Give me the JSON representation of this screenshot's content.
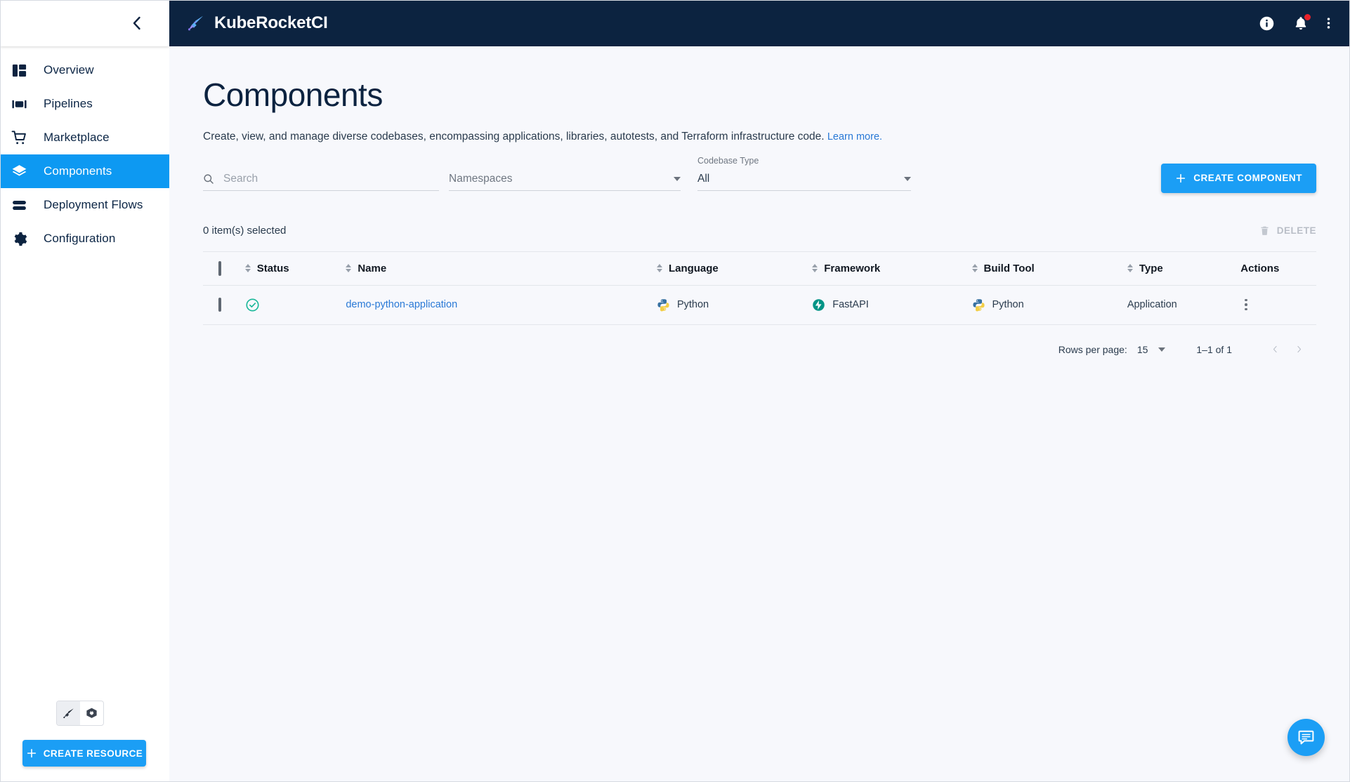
{
  "app": {
    "brand_name": "KubeRocketCI",
    "brand_logo_icon": "rocket-sword-logo-icon",
    "accent_color": "#1b9ef5",
    "topbar_color": "#0c2340",
    "background_color": "#f7f8fc"
  },
  "topbar": {
    "info_icon": "info-circle-icon",
    "notifications_icon": "bell-icon",
    "notifications_has_unread": true,
    "overflow_icon": "more-vertical-icon"
  },
  "sidebar": {
    "collapse_icon": "chevron-left-icon",
    "items": [
      {
        "label": "Overview",
        "icon": "dashboard-grid-icon",
        "active": false
      },
      {
        "label": "Pipelines",
        "icon": "pipelines-icon",
        "active": false
      },
      {
        "label": "Marketplace",
        "icon": "shopping-cart-icon",
        "active": false
      },
      {
        "label": "Components",
        "icon": "layers-icon",
        "active": true
      },
      {
        "label": "Deployment Flows",
        "icon": "deployment-flows-icon",
        "active": false
      },
      {
        "label": "Configuration",
        "icon": "gear-icon",
        "active": false
      }
    ],
    "view_toggle": [
      {
        "name": "krci-view",
        "icon": "rocket-sword-icon",
        "selected": true
      },
      {
        "name": "kubernetes-view",
        "icon": "kubernetes-wheel-icon",
        "selected": false
      }
    ],
    "create_resource_label": "CREATE RESOURCE",
    "create_resource_icon": "plus-icon"
  },
  "page": {
    "title": "Components",
    "description": "Create, view, and manage diverse codebases, encompassing applications, libraries, autotests, and Terraform infrastructure code.",
    "learn_more_label": "Learn more."
  },
  "filters": {
    "search": {
      "placeholder": "Search",
      "value": "",
      "icon": "search-icon"
    },
    "namespaces": {
      "label": "",
      "placeholder": "Namespaces",
      "value": "",
      "icon": "chevron-down-icon"
    },
    "codebase_type": {
      "label": "Codebase Type",
      "value": "All",
      "icon": "chevron-down-icon"
    },
    "create_component_label": "CREATE COMPONENT",
    "create_component_icon": "plus-icon"
  },
  "selection": {
    "summary": "0 item(s) selected",
    "delete_label": "DELETE",
    "delete_icon": "trash-icon"
  },
  "table": {
    "select_all_checkbox": "unchecked",
    "columns": [
      {
        "label": "Status",
        "sortable": true
      },
      {
        "label": "Name",
        "sortable": true
      },
      {
        "label": "Language",
        "sortable": true
      },
      {
        "label": "Framework",
        "sortable": true
      },
      {
        "label": "Build Tool",
        "sortable": true
      },
      {
        "label": "Type",
        "sortable": true
      },
      {
        "label": "Actions",
        "sortable": false
      }
    ],
    "rows": [
      {
        "checkbox": "unchecked",
        "status": "ok",
        "status_icon": "check-circle-icon",
        "status_color": "#1bb89a",
        "name": "demo-python-application",
        "language": "Python",
        "language_icon": "python-logo-icon",
        "framework": "FastAPI",
        "framework_icon": "fastapi-logo-icon",
        "framework_color": "#029486",
        "build_tool": "Python",
        "build_tool_icon": "python-logo-icon",
        "type": "Application",
        "actions_icon": "more-vertical-icon"
      }
    ]
  },
  "pagination": {
    "rows_per_page_label": "Rows per page:",
    "rows_per_page_value": "15",
    "range_label": "1–1 of 1",
    "prev_icon": "chevron-left-icon",
    "next_icon": "chevron-right-icon"
  },
  "fab": {
    "icon": "chat-message-icon",
    "color": "#1b9ef5"
  }
}
